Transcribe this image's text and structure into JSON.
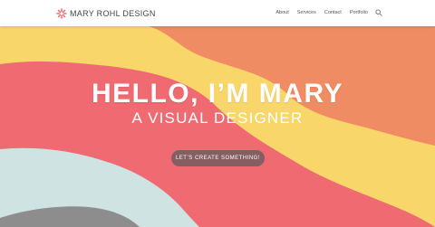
{
  "site": {
    "logo_text": "MARY ROHL DESIGN"
  },
  "nav": {
    "items": [
      {
        "label": "About"
      },
      {
        "label": "Services"
      },
      {
        "label": "Contact"
      },
      {
        "label": "Portfolio"
      }
    ]
  },
  "hero": {
    "headline": "HELLO, I’M MARY",
    "subheadline": "A VISUAL DESIGNER",
    "cta_label": "LET’S CREATE SOMETHING!"
  },
  "colors": {
    "orange": "#f08c63",
    "yellow": "#f9d66a",
    "coral": "#ef6b71",
    "mint": "#cfe3e2",
    "gray": "#8e8d8d",
    "logo_accent": "#ef6b71"
  },
  "icons": [
    "logo-flower-icon",
    "search-icon"
  ]
}
